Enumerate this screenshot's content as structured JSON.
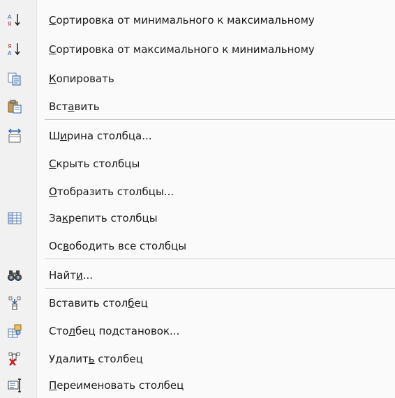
{
  "menu": {
    "items": [
      {
        "pre": "",
        "ul": "С",
        "post": "ортировка от минимального к максимальному",
        "icon": "sort-ascending-icon"
      },
      {
        "pre": "",
        "ul": "С",
        "post": "ортировка от максимального к минимальному",
        "icon": "sort-descending-icon"
      },
      {
        "pre": "",
        "ul": "К",
        "post": "опировать",
        "icon": "copy-icon"
      },
      {
        "pre": "Вст",
        "ul": "а",
        "post": "вить",
        "icon": "paste-icon"
      },
      {
        "pre": "Ш",
        "ul": "и",
        "post": "рина столбца...",
        "icon": "column-width-icon"
      },
      {
        "pre": "",
        "ul": "С",
        "post": "крыть столбцы",
        "icon": ""
      },
      {
        "pre": "",
        "ul": "О",
        "post": "тобразить столбцы...",
        "icon": ""
      },
      {
        "pre": "За",
        "ul": "к",
        "post": "репить столбцы",
        "icon": "freeze-columns-icon"
      },
      {
        "pre": "Ос",
        "ul": "в",
        "post": "ободить все столбцы",
        "icon": ""
      },
      {
        "pre": "Найт",
        "ul": "и",
        "post": "...",
        "icon": "binoculars-find-icon"
      },
      {
        "pre": "Вставить стол",
        "ul": "б",
        "post": "ец",
        "icon": "insert-column-icon"
      },
      {
        "pre": "Сто",
        "ul": "л",
        "post": "бец  подстановок...",
        "icon": "lookup-column-icon"
      },
      {
        "pre": "Удалит",
        "ul": "ь",
        "post": " столбец",
        "icon": "delete-column-icon"
      },
      {
        "pre": "",
        "ul": "П",
        "post": "ереименовать столбец",
        "icon": "rename-column-icon"
      }
    ],
    "colors": {
      "gutter": "#f1f1f1",
      "separator": "#c5c5c5",
      "text": "#1a1a1a",
      "accent_blue": "#2b5fa8",
      "delete_red": "#d42020"
    }
  }
}
